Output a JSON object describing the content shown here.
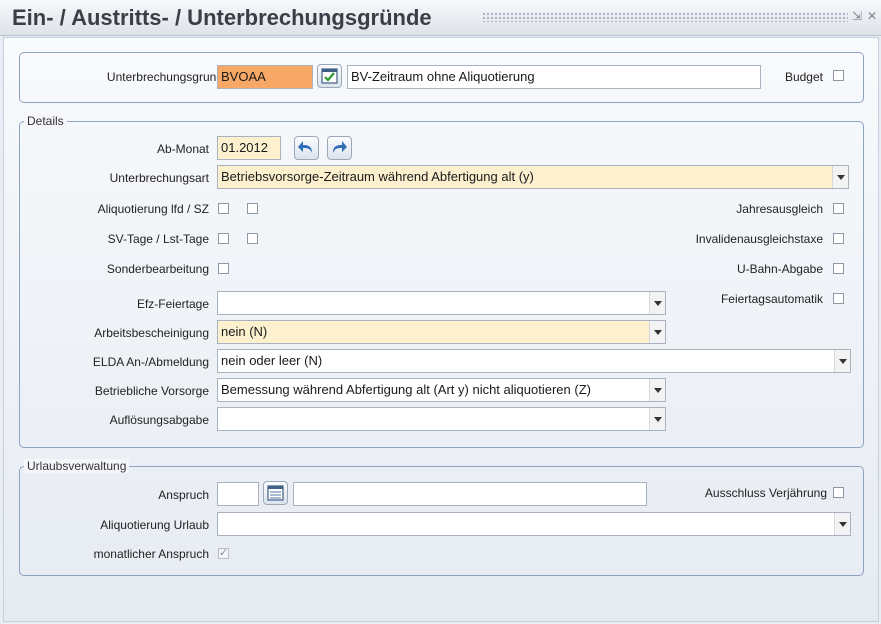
{
  "window": {
    "title": "Ein- / Austritts- / Unterbrechungsgründe",
    "minimize": "⇲",
    "close": "✕"
  },
  "top": {
    "reason_label": "Unterbrechungsgrund",
    "reason_code": "BVOAA",
    "reason_desc": "BV-Zeitraum ohne Aliquotierung",
    "budget_label": "Budget",
    "budget_checked": false
  },
  "details": {
    "legend": "Details",
    "ab_monat_label": "Ab-Monat",
    "ab_monat_value": "01.2012",
    "art_label": "Unterbrechungsart",
    "art_value": "Betriebsvorsorge-Zeitraum während Abfertigung alt (y)",
    "aliquot_label": "Aliquotierung lfd / SZ",
    "sv_label": "SV-Tage / Lst-Tage",
    "sonder_label": "Sonderbearbeitung",
    "jahres_label": "Jahresausgleich",
    "invaliden_label": "Invalidenausgleichstaxe",
    "ubahn_label": "U-Bahn-Abgabe",
    "feiertags_label": "Feiertagsautomatik",
    "efz_label": "Efz-Feiertage",
    "efz_value": "",
    "arbeits_label": "Arbeitsbescheinigung",
    "arbeits_value": "nein (N)",
    "elda_label": "ELDA An-/Abmeldung",
    "elda_value": "nein oder leer (N)",
    "vorsorge_label": "Betriebliche Vorsorge",
    "vorsorge_value": "Bemessung während Abfertigung alt (Art y) nicht aliquotieren (Z)",
    "aufloesung_label": "Auflösungsabgabe",
    "aufloesung_value": ""
  },
  "urlaub": {
    "legend": "Urlaubsverwaltung",
    "anspruch_label": "Anspruch",
    "anspruch_value": "",
    "anspruch_desc": "",
    "ausschluss_label": "Ausschluss Verjährung",
    "aliquot_label": "Aliquotierung Urlaub",
    "aliquot_value": "",
    "monatlich_label": "monatlicher Anspruch",
    "monatlich_checked": true
  },
  "colors": {
    "accent_orange": "#f7a867",
    "accent_yellow": "#fdf0cf",
    "frame_blue": "#8ea3c2"
  }
}
